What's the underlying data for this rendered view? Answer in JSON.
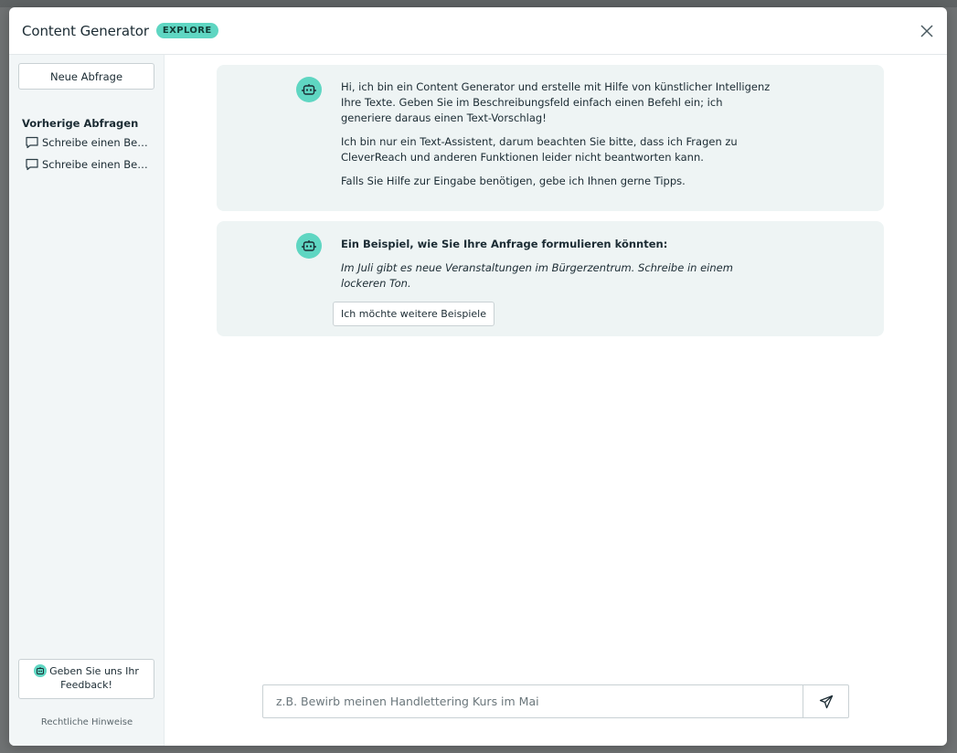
{
  "header": {
    "title": "Content Generator",
    "badge": "EXPLORE"
  },
  "sidebar": {
    "new_query_label": "Neue Abfrage",
    "history_title": "Vorherige Abfragen",
    "history": [
      {
        "label": "Schreibe einen Beitrag"
      },
      {
        "label": "Schreibe einen Beitrag"
      }
    ],
    "feedback_label": "Geben Sie uns Ihr Feedback!",
    "legal_label": "Rechtliche Hinweise"
  },
  "chat": {
    "intro": {
      "p1": "Hi, ich bin ein Content Generator und erstelle mit Hilfe von künstlicher Intelligenz Ihre Texte. Geben Sie im Beschreibungsfeld einfach einen Befehl ein; ich generiere daraus einen Text-Vorschlag!",
      "p2": "Ich bin nur ein Text-Assistent, darum beachten Sie bitte, dass ich Fragen zu CleverReach und anderen Funktionen leider nicht beantworten kann.",
      "p3": "Falls Sie Hilfe zur Eingabe benötigen, gebe ich Ihnen gerne Tipps."
    },
    "example": {
      "title": "Ein Beispiel, wie Sie Ihre Anfrage formulieren könnten:",
      "text": "Im Juli gibt es neue Veranstaltungen im Bürgerzentrum. Schreibe in einem lockeren Ton.",
      "more_button": "Ich möchte weitere Beispiele"
    }
  },
  "input": {
    "placeholder": "z.B. Bewirb meinen Handlettering Kurs im Mai"
  },
  "colors": {
    "accent": "#5fd6c2",
    "card_bg": "#eef4f4",
    "sidebar_bg": "#f2f6f7"
  },
  "icons": {
    "close": "close-icon",
    "bot": "robot-icon",
    "history": "chat-bubble-icon",
    "send": "paper-plane-icon"
  }
}
